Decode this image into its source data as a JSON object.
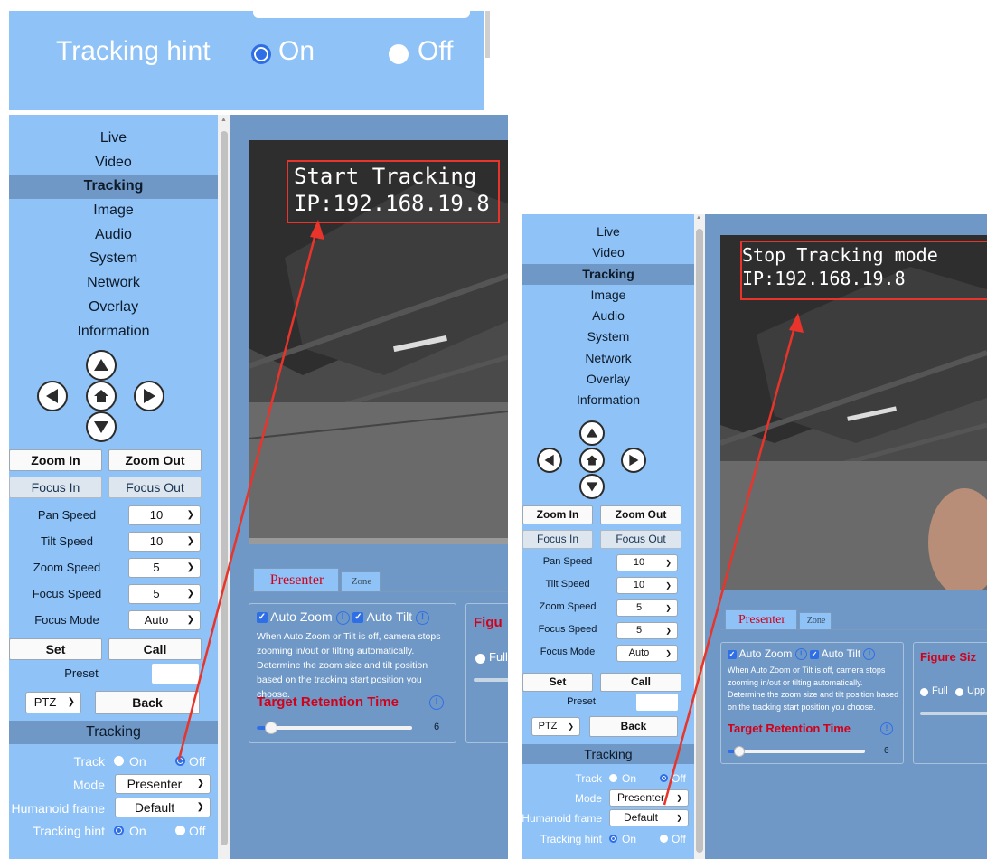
{
  "zoom_crop": {
    "label": "Tracking hint",
    "on": "On",
    "off": "Off"
  },
  "nav": [
    "Live",
    "Video",
    "Tracking",
    "Image",
    "Audio",
    "System",
    "Network",
    "Overlay",
    "Information"
  ],
  "nav_active": "Tracking",
  "ptz_buttons": {
    "zoom_in": "Zoom In",
    "zoom_out": "Zoom Out",
    "focus_in": "Focus In",
    "focus_out": "Focus Out",
    "set": "Set",
    "call": "Call",
    "back": "Back"
  },
  "speeds": [
    {
      "label": "Pan Speed",
      "value": "10"
    },
    {
      "label": "Tilt Speed",
      "value": "10"
    },
    {
      "label": "Zoom Speed",
      "value": "5"
    },
    {
      "label": "Focus Speed",
      "value": "5"
    },
    {
      "label": "Focus Mode",
      "value": "Auto"
    }
  ],
  "preset": {
    "label": "Preset",
    "mode": "PTZ"
  },
  "tracking_section": {
    "title": "Tracking",
    "track_label": "Track",
    "mode_label": "Mode",
    "mode_value": "Presenter",
    "humanoid_label": "Humanoid frame",
    "humanoid_value": "Default",
    "hint_label": "Tracking hint",
    "on": "On",
    "off": "Off"
  },
  "screens": [
    {
      "osd_line1": "Start Tracking",
      "osd_line2": "IP:192.168.19.8"
    },
    {
      "osd_line1": "Stop Tracking mode",
      "osd_line2": "IP:192.168.19.8"
    }
  ],
  "tabs": {
    "presenter": "Presenter",
    "zone": "Zone"
  },
  "settings": {
    "auto_zoom": "Auto Zoom",
    "auto_tilt": "Auto Tilt",
    "description": "When Auto Zoom or Tilt is off, camera stops zooming in/out or tilting automatically. Determine the zoom size and tilt position based on the tracking start position you choose.",
    "retention_title": "Target Retention Time",
    "retention_value": "6",
    "figure_title_short": "Figu",
    "figure_title": "Figure Siz",
    "full": "Full",
    "upper": "Upp"
  },
  "colors": {
    "panel": "#8fc2f6",
    "active": "#6f98c6",
    "content": "#6f98c6",
    "red_box": "#e8342a",
    "red_title": "#d0021b",
    "radio_blue": "#2f6fe6"
  },
  "icons": [
    "up-arrow-icon",
    "left-arrow-icon",
    "home-icon",
    "right-arrow-icon",
    "down-arrow-icon",
    "info-icon",
    "checkbox-icon",
    "chevron-down-icon"
  ]
}
